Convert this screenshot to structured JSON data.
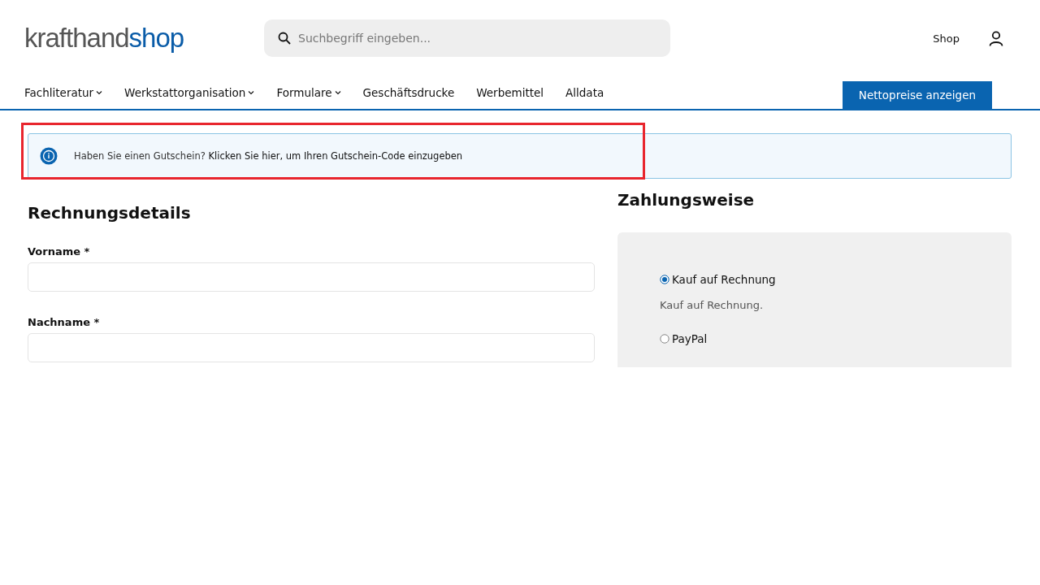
{
  "header": {
    "logo": {
      "part_1": "krafthand",
      "part_2": "shop"
    },
    "search": {
      "placeholder": "Suchbegriff eingeben..."
    },
    "shop_link": "Shop"
  },
  "nav": {
    "items": [
      {
        "label": "Fachliteratur",
        "has_dropdown": true
      },
      {
        "label": "Werkstattorganisation",
        "has_dropdown": true
      },
      {
        "label": "Formulare",
        "has_dropdown": true
      },
      {
        "label": "Geschäftsdrucke",
        "has_dropdown": false
      },
      {
        "label": "Werbemittel",
        "has_dropdown": false
      },
      {
        "label": "Alldata",
        "has_dropdown": false
      }
    ],
    "button": "Nettopreise anzeigen"
  },
  "notice": {
    "text": "Haben Sie einen Gutschein?",
    "link": "Klicken Sie hier, um Ihren Gutschein-Code einzugeben"
  },
  "billing": {
    "title": "Rechnungsdetails",
    "fields": [
      {
        "label": "Vorname *"
      },
      {
        "label": "Nachname *"
      }
    ]
  },
  "payment": {
    "title": "Zahlungsweise",
    "methods": [
      {
        "label": "Kauf auf Rechnung",
        "selected": true,
        "description": "Kauf auf Rechnung."
      },
      {
        "label": "PayPal",
        "selected": false
      }
    ]
  }
}
